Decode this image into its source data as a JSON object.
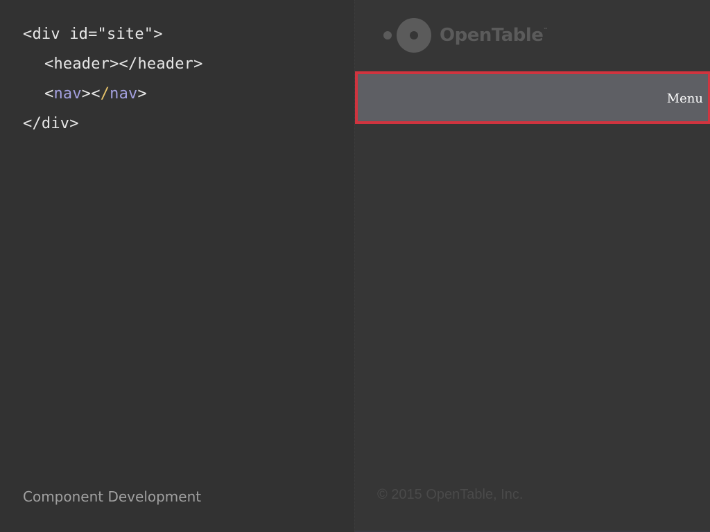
{
  "code": {
    "line1": "<div id=\"site\">",
    "line2": "<header></header>",
    "line3": {
      "open_bracket": "<",
      "open_tag": "nav",
      "mid": "><",
      "slash": "/",
      "close_tag": "nav",
      "end": ">"
    },
    "line4": "</div>"
  },
  "footer": {
    "title": "Component Development"
  },
  "demo": {
    "logo": {
      "brand": "OpenTable",
      "trademark": "™",
      "icon": "opentable-logo-icon"
    },
    "nav": {
      "menu_label": "Menu"
    },
    "copyright": "© 2015 OpenTable, Inc."
  },
  "colors": {
    "background": "#323232",
    "nav_highlight_border": "#d0343f",
    "nav_fill": "#5e5f64",
    "code_purple": "#a4a1e0",
    "code_yellow": "#e8c46a"
  }
}
